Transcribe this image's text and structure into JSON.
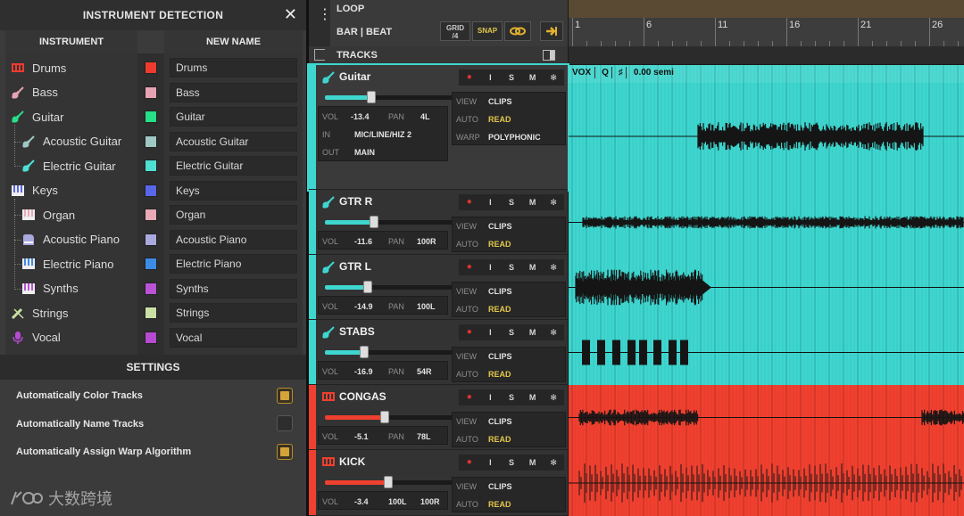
{
  "panel": {
    "title": "INSTRUMENT DETECTION",
    "close_icon": "close-icon",
    "col_instrument": "INSTRUMENT",
    "col_new_name": "NEW NAME",
    "instruments": [
      {
        "label": "Drums",
        "new_name": "Drums",
        "color": "#ef3b2f",
        "icon": "drums-icon",
        "indent": 0
      },
      {
        "label": "Bass",
        "new_name": "Bass",
        "color": "#e7a3b4",
        "icon": "bass-guitar-icon",
        "indent": 0
      },
      {
        "label": "Guitar",
        "new_name": "Guitar",
        "color": "#27df87",
        "icon": "guitar-icon",
        "indent": 0
      },
      {
        "label": "Acoustic Guitar",
        "new_name": "Acoustic Guitar",
        "color": "#9fc7c4",
        "icon": "acoustic-guitar-icon",
        "indent": 1
      },
      {
        "label": "Electric Guitar",
        "new_name": "Electric Guitar",
        "color": "#4fe0d4",
        "icon": "electric-guitar-icon",
        "indent": 1
      },
      {
        "label": "Keys",
        "new_name": "Keys",
        "color": "#5966e8",
        "icon": "keys-icon",
        "indent": 0
      },
      {
        "label": "Organ",
        "new_name": "Organ",
        "color": "#e9a9b6",
        "icon": "organ-icon",
        "indent": 1
      },
      {
        "label": "Acoustic Piano",
        "new_name": "Acoustic Piano",
        "color": "#a9a9de",
        "icon": "acoustic-piano-icon",
        "indent": 1
      },
      {
        "label": "Electric Piano",
        "new_name": "Electric Piano",
        "color": "#3c8ce6",
        "icon": "electric-piano-icon",
        "indent": 1
      },
      {
        "label": "Synths",
        "new_name": "Synths",
        "color": "#bb52d6",
        "icon": "synth-icon",
        "indent": 1
      },
      {
        "label": "Strings",
        "new_name": "Strings",
        "color": "#cbe0a4",
        "icon": "strings-icon",
        "indent": 0
      },
      {
        "label": "Vocal",
        "new_name": "Vocal",
        "color": "#b64ad0",
        "icon": "microphone-icon",
        "indent": 0
      }
    ],
    "settings_title": "SETTINGS",
    "settings": [
      {
        "label": "Automatically Color Tracks",
        "checked": true
      },
      {
        "label": "Automatically Name Tracks",
        "checked": false
      },
      {
        "label": "Automatically Assign Warp Algorithm",
        "checked": true
      }
    ],
    "watermark": "大数跨境"
  },
  "arranger": {
    "loop_label": "LOOP",
    "bar_beat_label": "BAR | BEAT",
    "grid_label": "GRID",
    "grid_value": "/4",
    "snap_label": "SNAP",
    "tracks_label": "TRACKS",
    "ruler_marks": [
      "1",
      "6",
      "11",
      "16",
      "21",
      "26"
    ],
    "clip_header": {
      "name": "VOX",
      "q": "Q",
      "sharp": "♯",
      "pitch": "0.00 semi"
    },
    "tracks": [
      {
        "name": "Guitar",
        "color": "#3ed6cf",
        "selected": true,
        "vol": "-13.4",
        "pan": "4L",
        "fader": 0.36,
        "in_label": "IN",
        "in": "MIC/LINE/HIZ 2",
        "out_label": "OUT",
        "out": "MAIN",
        "view": "CLIPS",
        "auto": "READ",
        "warp_label": "WARP",
        "warp": "POLYPHONIC"
      },
      {
        "name": "GTR R",
        "color": "#3ed6cf",
        "vol": "-11.6",
        "pan": "100R",
        "fader": 0.38,
        "view": "CLIPS",
        "auto": "READ"
      },
      {
        "name": "GTR  L",
        "color": "#3ed6cf",
        "vol": "-14.9",
        "pan": "100L",
        "fader": 0.33,
        "view": "CLIPS",
        "auto": "READ"
      },
      {
        "name": "STABS",
        "color": "#3ed6cf",
        "vol": "-16.9",
        "pan": "54R",
        "fader": 0.3,
        "view": "CLIPS",
        "auto": "READ"
      },
      {
        "name": "CONGAS",
        "color": "#f0402f",
        "vol": "-5.1",
        "pan": "78L",
        "fader": 0.46,
        "view": "CLIPS",
        "auto": "READ"
      },
      {
        "name": "KICK",
        "color": "#f0402f",
        "vol": "-3.4",
        "pan": "100L",
        "pan2": "100R",
        "fader": 0.49,
        "view": "CLIPS",
        "auto": "READ"
      }
    ],
    "labels": {
      "vol": "VOL",
      "pan": "PAN",
      "view": "VIEW",
      "auto": "AUTO",
      "i": "I",
      "s": "S",
      "m": "M"
    }
  }
}
